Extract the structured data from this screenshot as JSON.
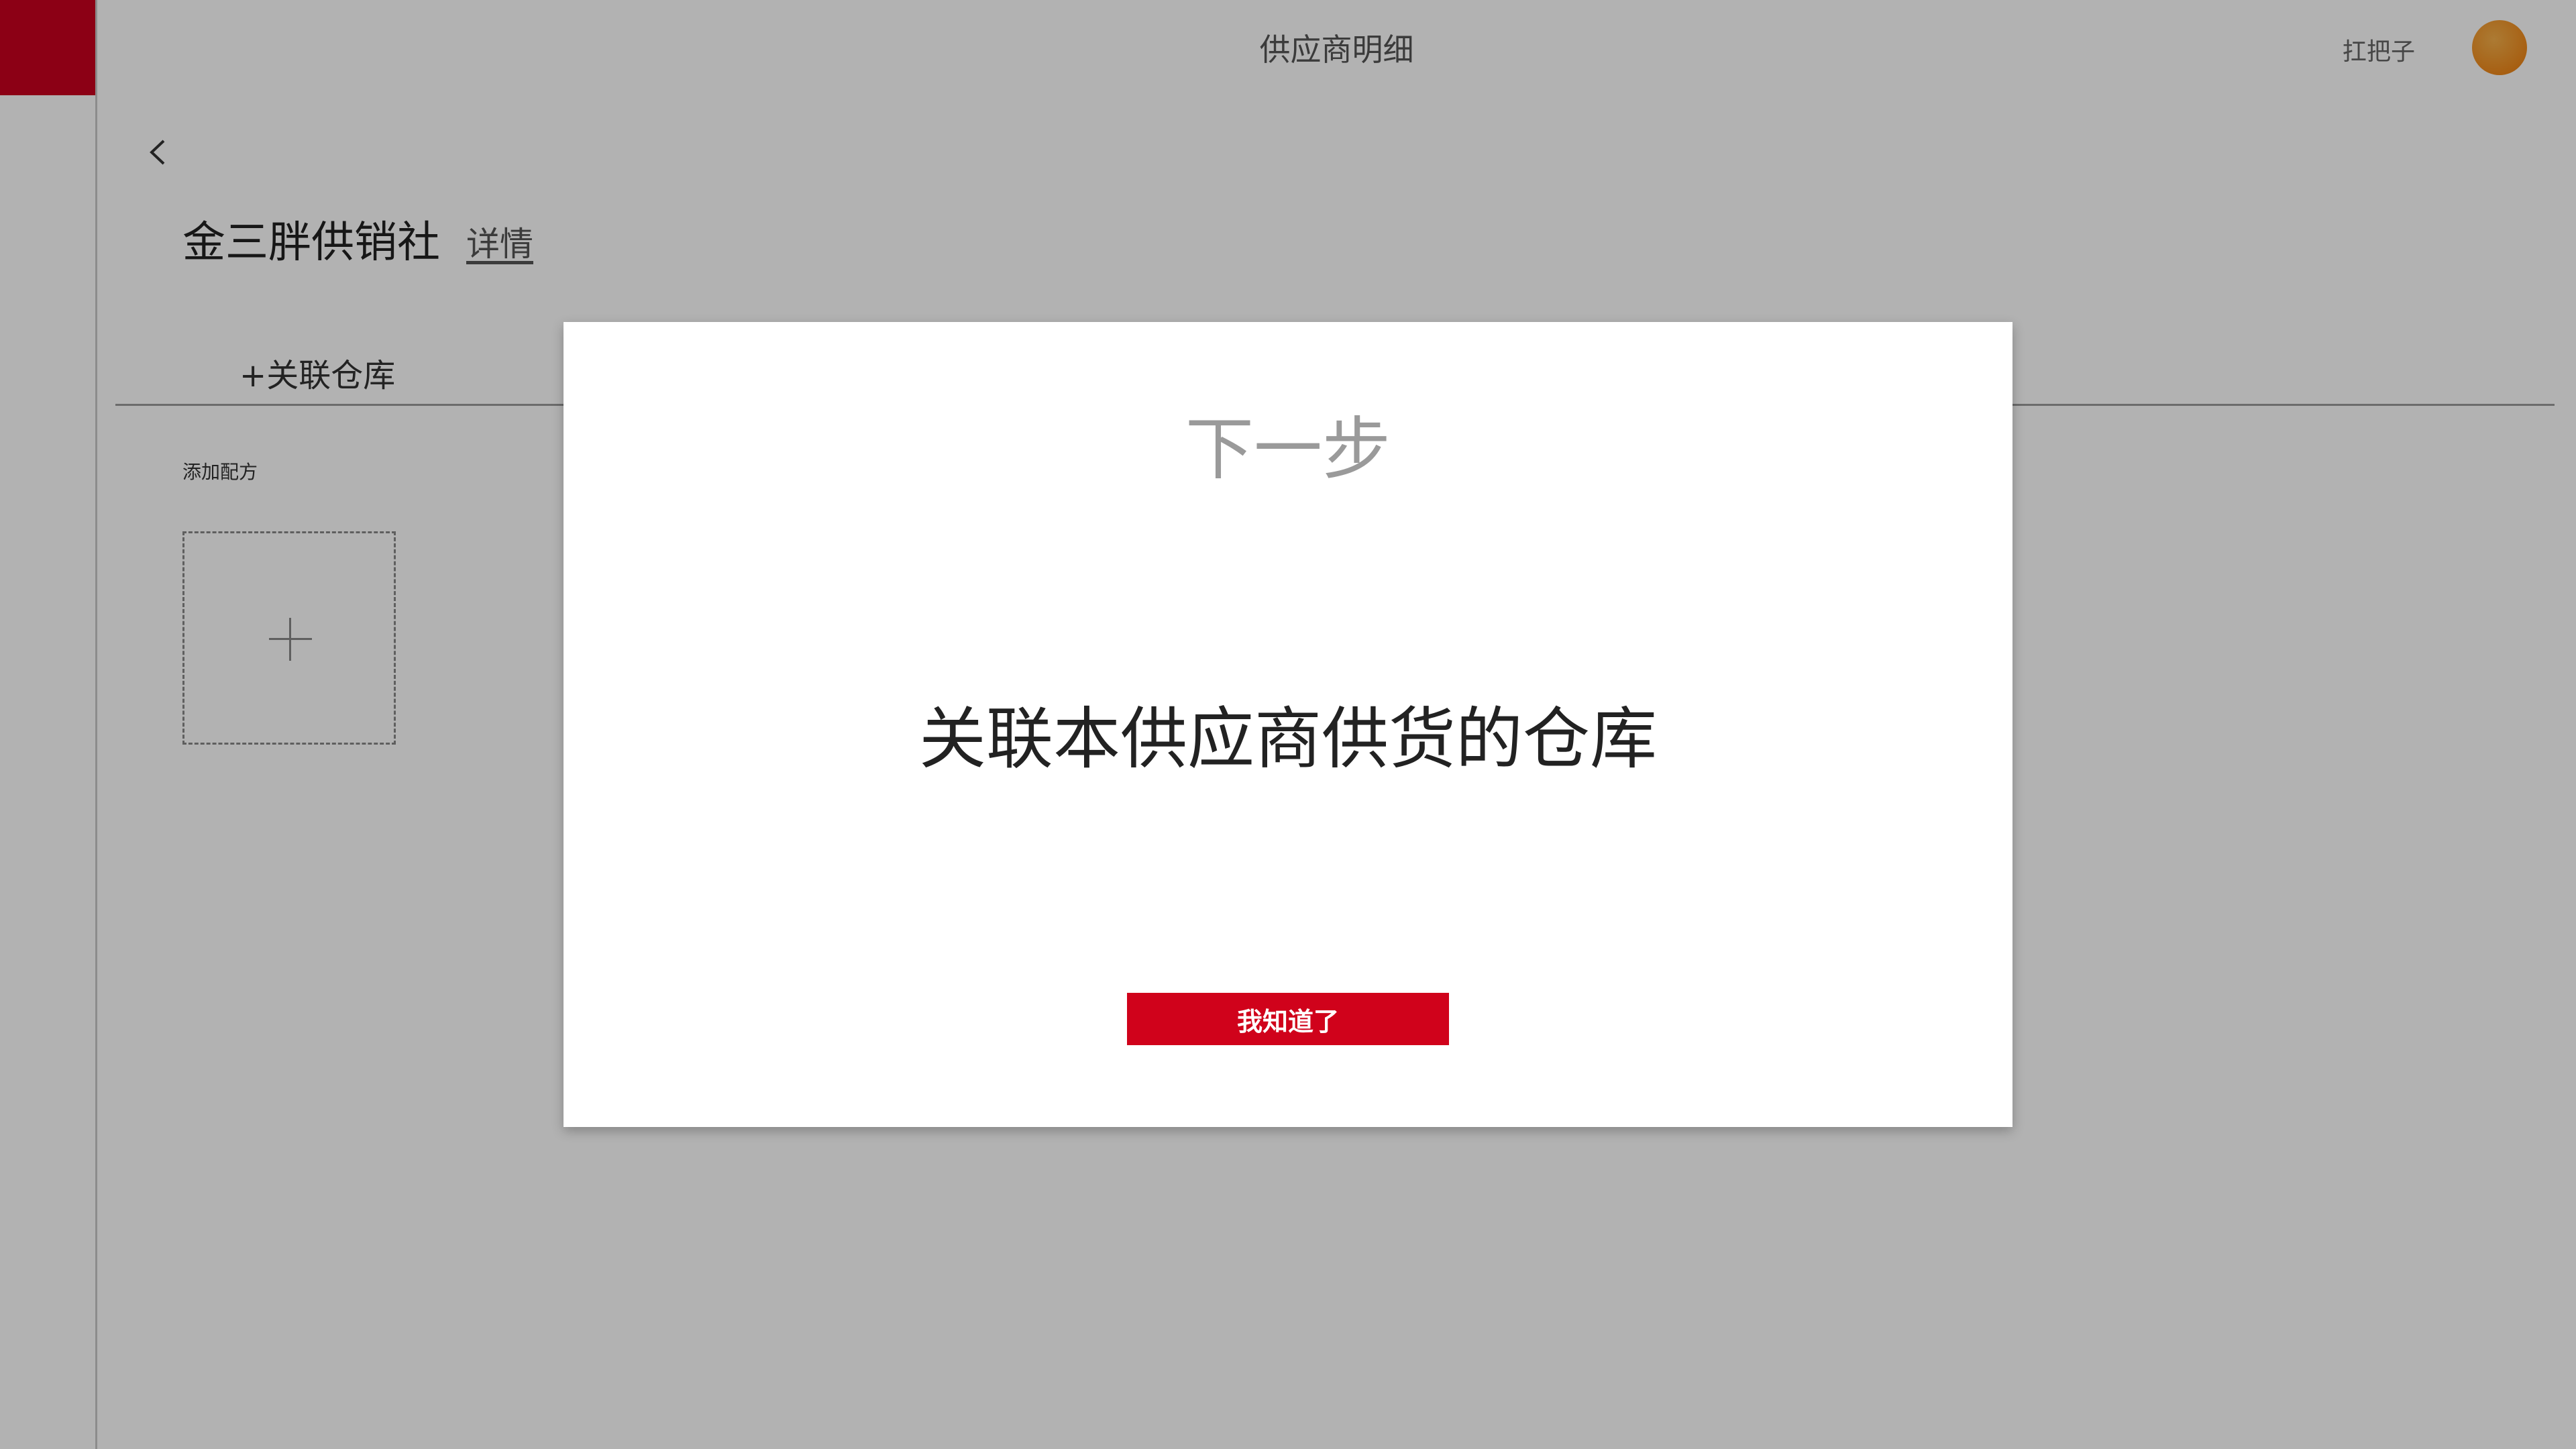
{
  "header": {
    "title": "供应商明细",
    "user_name": "扛把子"
  },
  "main": {
    "back_icon": "chevron-left-icon",
    "supplier_name": "金三胖供销社",
    "details_link": "详情",
    "tab_link_warehouse": "+关联仓库",
    "section_label": "添加配方",
    "add_icon": "plus-icon"
  },
  "modal": {
    "title": "下一步",
    "message": "关联本供应商供货的仓库",
    "ok_button": "我知道了"
  },
  "colors": {
    "brand": "#c9001f",
    "button": "#d0021b",
    "avatar": "#f08a1c"
  }
}
